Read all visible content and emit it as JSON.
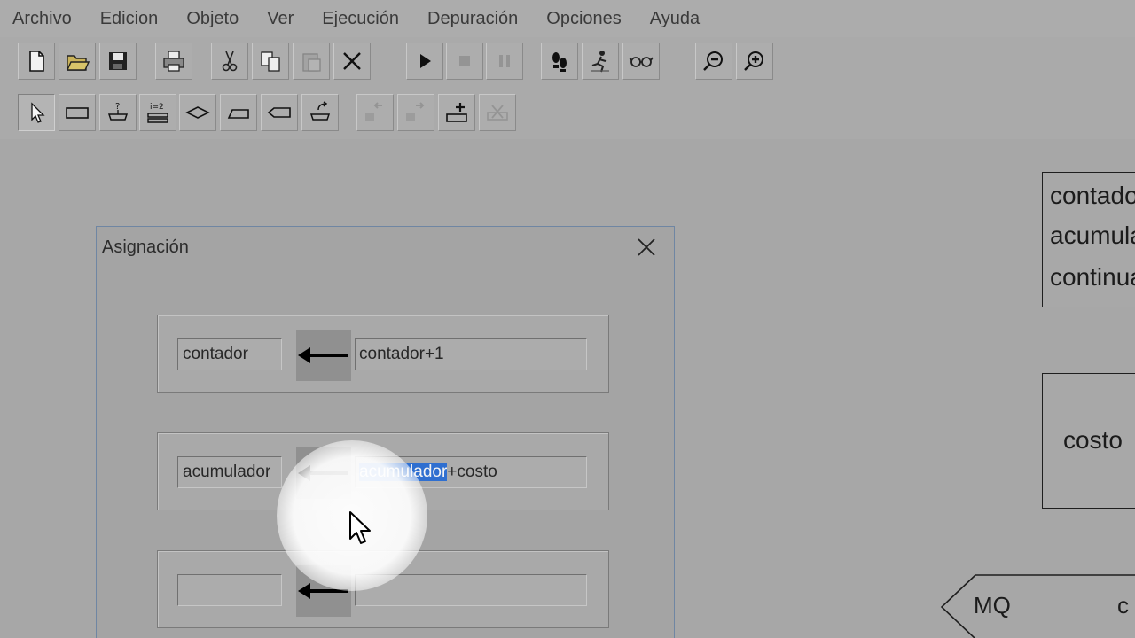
{
  "menu": [
    "Archivo",
    "Edicion",
    "Objeto",
    "Ver",
    "Ejecución",
    "Depuración",
    "Opciones",
    "Ayuda"
  ],
  "toolbar": {
    "row1": [
      "new-file-icon",
      "open-folder-icon",
      "save-icon",
      "print-icon",
      "cut-icon",
      "copy-icon",
      "paste-icon",
      "delete-icon",
      "run-icon",
      "stop-icon",
      "pause-icon",
      "step-icon",
      "step-run-icon",
      "inspect-glasses-icon",
      "zoom-out-icon",
      "zoom-in-icon"
    ],
    "row2": [
      "select-pointer-icon",
      "assignment-shape-icon",
      "input-shape-icon",
      "for-loop-shape-icon",
      "decision-shape-icon",
      "while-shape-icon",
      "repeat-shape-icon",
      "output-shape-icon",
      "move-left-icon",
      "move-right-icon",
      "insert-icon",
      "remove-icon"
    ]
  },
  "canvas": {
    "block1_lines": [
      "contador",
      "acumulador",
      "continuar"
    ],
    "block2_text": "costo",
    "mq_label": "MQ",
    "mq_extra": "c"
  },
  "dialog": {
    "title": "Asignación",
    "rows": [
      {
        "variable": "contador",
        "expression": "contador+1"
      },
      {
        "variable": "acumulador",
        "expression_selected": "acumulador",
        "expression_rest": "+costo"
      },
      {
        "variable": "",
        "expression": ""
      }
    ]
  }
}
